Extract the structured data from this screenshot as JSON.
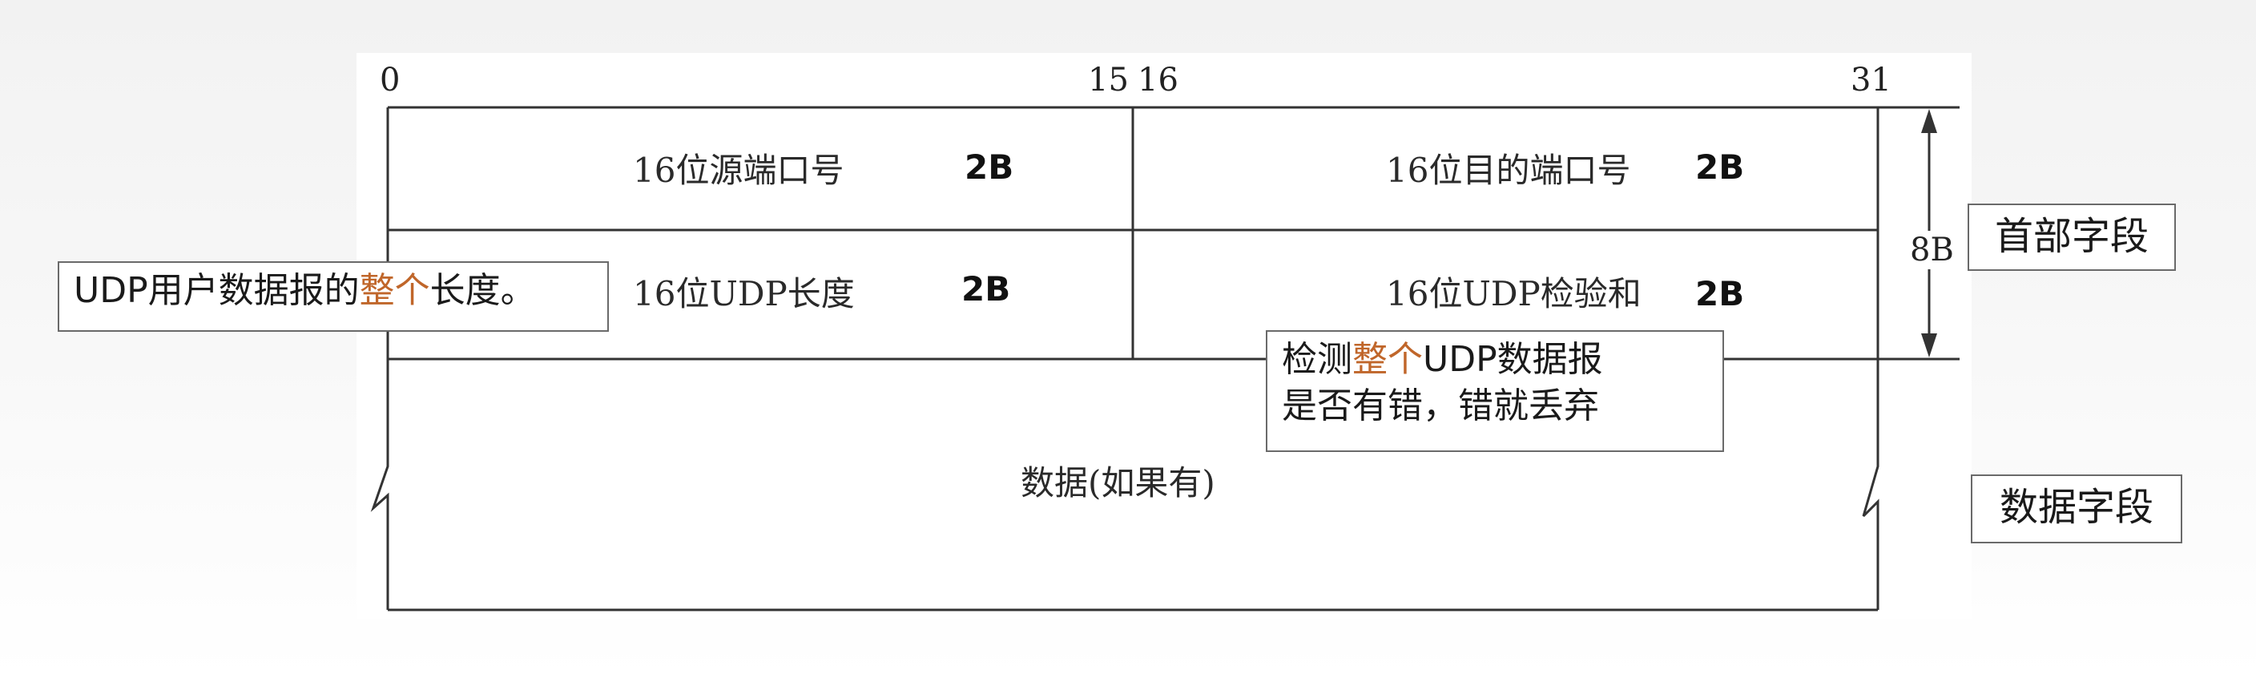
{
  "bit_labels": {
    "b0": "0",
    "b15": "15",
    "b16": "16",
    "b31": "31"
  },
  "header": {
    "src_port": {
      "label": "16位源端口号",
      "size": "2B"
    },
    "dst_port": {
      "label": "16位目的端口号",
      "size": "2B"
    },
    "length": {
      "label": "16位UDP长度",
      "size": "2B"
    },
    "checksum": {
      "label": "16位UDP检验和",
      "size": "2B"
    }
  },
  "data_field": {
    "label": "数据(如果有)"
  },
  "header_size": "8B",
  "side_labels": {
    "header": "首部字段",
    "data": "数据字段"
  },
  "notes": {
    "length_note": {
      "pre": "UDP用户数据报的",
      "highlight": "整个",
      "post": "长度。"
    },
    "checksum_note": {
      "line1_pre": "检测",
      "line1_highlight": "整个",
      "line1_post": "UDP数据报",
      "line2": "是否有错，错就丢弃"
    }
  },
  "colors": {
    "highlight": "#c0662a",
    "line": "#333333",
    "box_border": "#6a6a6a"
  }
}
